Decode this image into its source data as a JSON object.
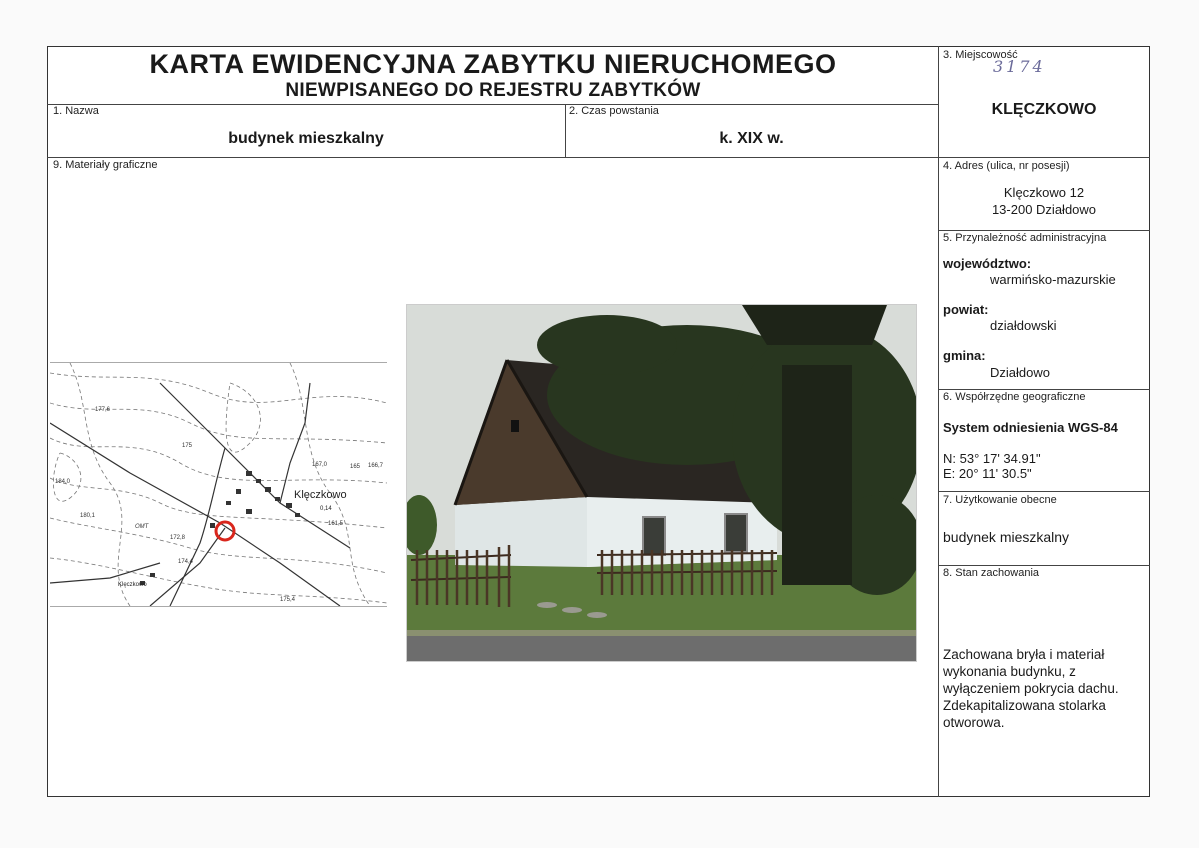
{
  "header": {
    "title_line1": "KARTA EWIDENCYJNA ZABYTKU NIERUCHOMEGO",
    "title_line2": "NIEWPISANEGO DO REJESTRU ZABYTKÓW"
  },
  "fields": {
    "nazwa_label": "1. Nazwa",
    "nazwa_value": "budynek mieszkalny",
    "czas_label": "2. Czas powstania",
    "czas_value": "k. XIX w.",
    "miejscowosc_label": "3. Miejscowość",
    "miejscowosc_value": "KLĘCZKOWO",
    "inventory_number": "3174",
    "adres_label": "4. Adres (ulica, nr posesji)",
    "adres_line1": "Klęczkowo 12",
    "adres_line2": "13-200 Działdowo",
    "przynaleznosc_label": "5. Przynależność administracyjna",
    "wojewodztwo_label": "województwo:",
    "wojewodztwo_value": "warmińsko-mazurskie",
    "powiat_label": "powiat:",
    "powiat_value": "działdowski",
    "gmina_label": "gmina:",
    "gmina_value": "Działdowo",
    "wspolrzedne_label": "6. Współrzędne geograficzne",
    "system_value": "System odniesienia WGS-84",
    "coord_n": "N: 53° 17' 34.91\"",
    "coord_e": "E: 20° 11' 30.5\"",
    "uzytkowanie_label": "7. Użytkowanie obecne",
    "uzytkowanie_value": "budynek mieszkalny",
    "stan_label": "8. Stan zachowania",
    "stan_line1": "Zachowana bryła i materiał",
    "stan_line2": "wykonania budynku, z",
    "stan_line3": "wyłączeniem pokrycia dachu.",
    "stan_line4": "Zdekapitalizowana stolarka",
    "stan_line5": "otworowa.",
    "materialy_label": "9. Materiały graficzne"
  },
  "map": {
    "town_label": "Klęczkowo",
    "town_label_small": "Klęczkowo",
    "town_sub": "0,14",
    "labels": [
      "177,6",
      "175",
      "175,4",
      "167,0",
      "165",
      "184,0",
      "180,1",
      "OMT",
      "172,8",
      "174,4",
      "161,5",
      "166,7"
    ],
    "marker_color": "#d9261c"
  },
  "photo": {
    "sky_color": "#d8dcd8",
    "wall_color": "#dfe6e6",
    "roof_color": "#2a2622",
    "tree_color": "#28361f",
    "grass_color": "#5c7a3c"
  }
}
